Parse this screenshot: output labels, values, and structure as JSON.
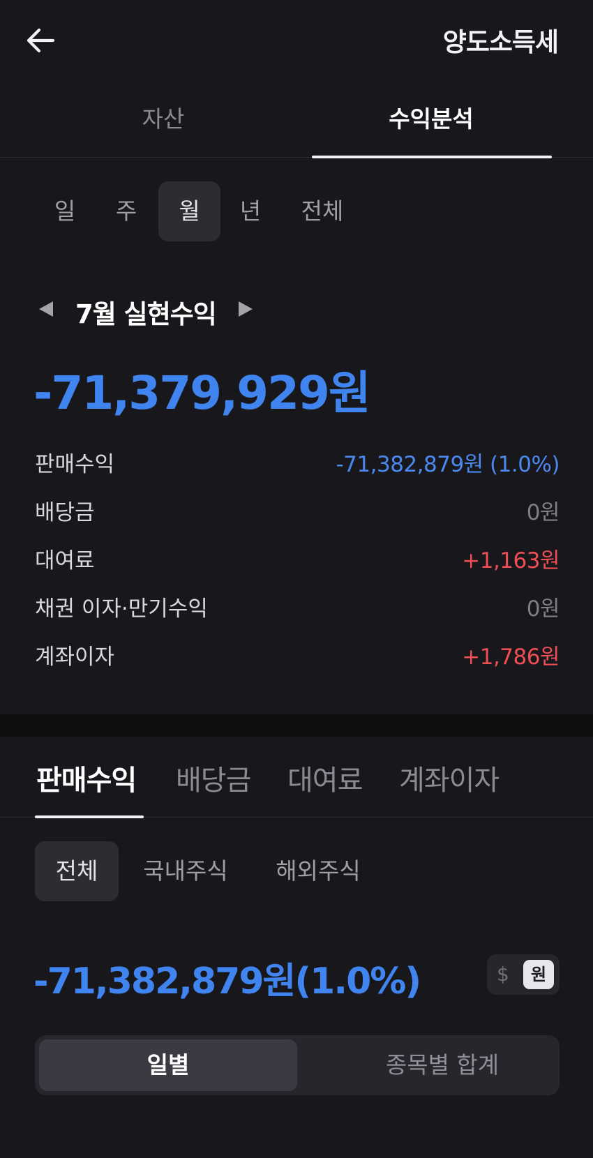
{
  "header": {
    "title": "양도소득세",
    "back_icon": "arrow-left-icon"
  },
  "top_tabs": [
    {
      "label": "자산",
      "active": false
    },
    {
      "label": "수익분석",
      "active": true
    }
  ],
  "period_tabs": [
    "일",
    "주",
    "월",
    "년",
    "전체"
  ],
  "period_selected": "월",
  "summary": {
    "title": "7월 실현수익",
    "total": "-71,379,929원"
  },
  "breakdown": [
    {
      "label": "판매수익",
      "value": "-71,382,879원 (1.0%)",
      "tone": "blue"
    },
    {
      "label": "배당금",
      "value": "0원",
      "tone": "gray"
    },
    {
      "label": "대여료",
      "value": "+1,163원",
      "tone": "red"
    },
    {
      "label": "채권 이자·만기수익",
      "value": "0원",
      "tone": "gray"
    },
    {
      "label": "계좌이자",
      "value": "+1,786원",
      "tone": "red"
    }
  ],
  "income_tabs": [
    {
      "label": "판매수익",
      "active": true
    },
    {
      "label": "배당금",
      "active": false
    },
    {
      "label": "대여료",
      "active": false
    },
    {
      "label": "계좌이자",
      "active": false
    }
  ],
  "market_filters": [
    {
      "label": "전체",
      "active": true
    },
    {
      "label": "국내주식",
      "active": false
    },
    {
      "label": "해외주식",
      "active": false
    }
  ],
  "sale_profit": "-71,382,879원(1.0%)",
  "currency": {
    "usd": "$",
    "krw": "원",
    "selected": "원"
  },
  "view_segments": [
    {
      "label": "일별",
      "active": true
    },
    {
      "label": "종목별 합계",
      "active": false
    }
  ],
  "colors": {
    "accent_blue": "#3f84ef",
    "positive_red": "#ef4f54",
    "background": "#17171c"
  }
}
